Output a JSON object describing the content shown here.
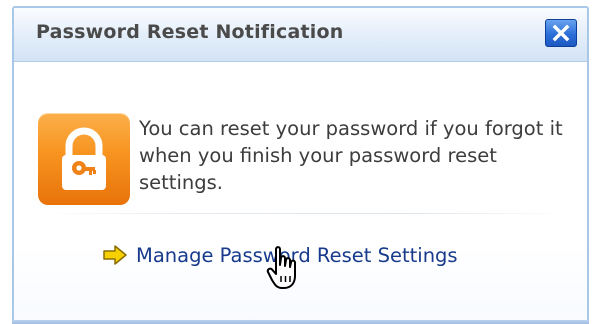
{
  "dialog": {
    "title": "Password Reset Notification",
    "close_label": "Close",
    "message": "You can reset your password if you forgot it when you finish your password reset settings.",
    "link_label": "Manage Password Reset Settings"
  },
  "icons": {
    "close": "close-icon",
    "lock": "padlock-key-icon",
    "arrow": "yellow-right-arrow-icon",
    "cursor": "hand-pointer-cursor"
  },
  "colors": {
    "title_bar": "#dce9f7",
    "close_button": "#2b6fd9",
    "lock_tile": "#f7931f",
    "link": "#173a8c",
    "arrow": "#f6d000"
  }
}
